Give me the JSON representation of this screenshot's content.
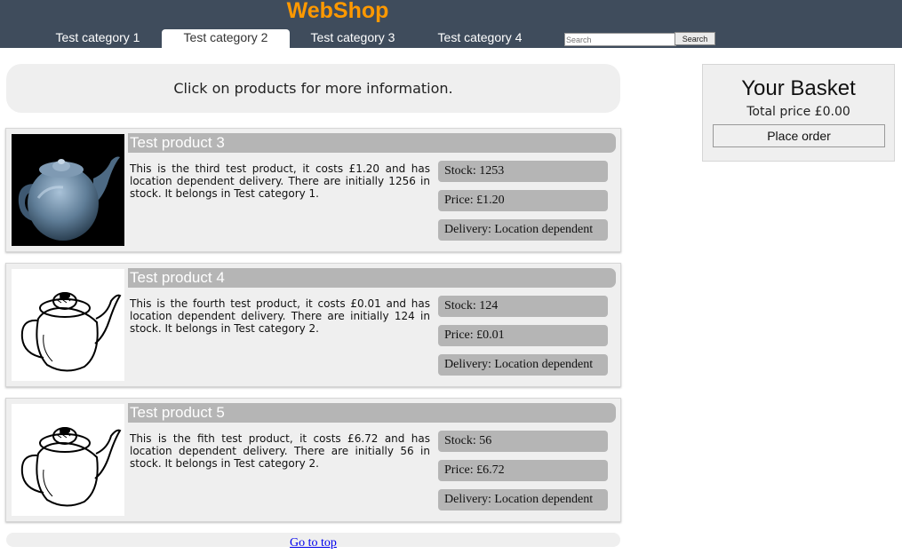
{
  "header": {
    "logo": "WebShop",
    "tabs": [
      {
        "label": "Test category 1",
        "active": false
      },
      {
        "label": "Test category 2",
        "active": true
      },
      {
        "label": "Test category 3",
        "active": false
      },
      {
        "label": "Test category 4",
        "active": false
      }
    ],
    "search": {
      "placeholder": "Search",
      "value": "",
      "button_label": "Search"
    },
    "colors": {
      "bar": "#3f4c5c",
      "logo": "#ff9900"
    }
  },
  "info": {
    "text": "Click on products for more information."
  },
  "products": [
    {
      "title": "Test product 3",
      "description": "This is the third test product, it costs £1.20 and has location dependent delivery. There are initially 1256 in stock. It belongs in Test category 1.",
      "stock": "Stock: 1253",
      "price": "Price: £1.20",
      "delivery": "Delivery: Location dependent",
      "image_icon": "teapot-photo"
    },
    {
      "title": "Test product 4",
      "description": "This is the fourth test product, it costs £0.01 and has location dependent delivery. There are initially 124 in stock. It belongs in Test category 2.",
      "stock": "Stock: 124",
      "price": "Price: £0.01",
      "delivery": "Delivery: Location dependent",
      "image_icon": "teapot-sketch"
    },
    {
      "title": "Test product 5",
      "description": "This is the fith test product, it costs £6.72 and has location dependent delivery. There are initially 56 in stock. It belongs in Test category 2.",
      "stock": "Stock: 56",
      "price": "Price: £6.72",
      "delivery": "Delivery: Location dependent",
      "image_icon": "teapot-sketch"
    }
  ],
  "footer": {
    "go_to_top": "Go to top"
  },
  "basket": {
    "title": "Your Basket",
    "total": "Total price £0.00",
    "place_order": "Place order"
  }
}
